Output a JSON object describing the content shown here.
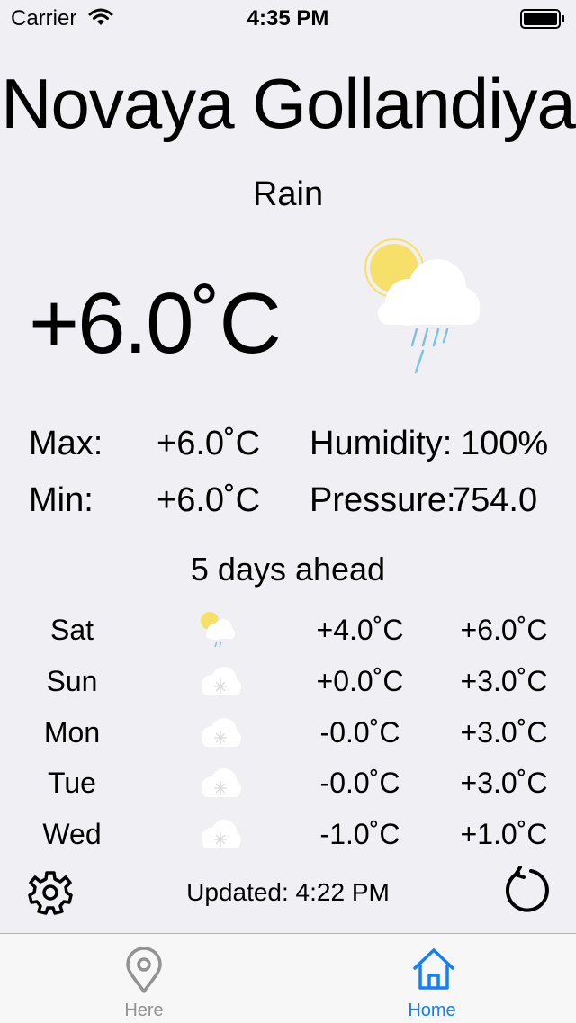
{
  "status_bar": {
    "carrier": "Carrier",
    "time": "4:35 PM"
  },
  "city": "Novaya Gollandiya",
  "condition": "Rain",
  "current_temp": "+6.0˚C",
  "stats": {
    "max_label": "Max:",
    "max_value": "+6.0˚C",
    "min_label": "Min:",
    "min_value": "+6.0˚C",
    "humidity_label": "Humidity:",
    "humidity_value": "100%",
    "pressure_label": "Pressure:",
    "pressure_value": "754.0"
  },
  "forecast_title": "5 days ahead",
  "forecast": [
    {
      "day": "Sat",
      "icon": "sun-rain-icon",
      "min": "+4.0˚C",
      "max": "+6.0˚C"
    },
    {
      "day": "Sun",
      "icon": "snow-cloud-icon",
      "min": "+0.0˚C",
      "max": "+3.0˚C"
    },
    {
      "day": "Mon",
      "icon": "snow-cloud-icon",
      "min": "-0.0˚C",
      "max": "+3.0˚C"
    },
    {
      "day": "Tue",
      "icon": "snow-cloud-icon",
      "min": "-0.0˚C",
      "max": "+3.0˚C"
    },
    {
      "day": "Wed",
      "icon": "snow-cloud-icon",
      "min": "-1.0˚C",
      "max": "+1.0˚C"
    }
  ],
  "updated": "Updated: 4:22 PM",
  "tabs": [
    {
      "label": "Here",
      "icon": "location-pin-icon",
      "selected": false
    },
    {
      "label": "Home",
      "icon": "home-icon",
      "selected": true
    }
  ],
  "colors": {
    "accent": "#147efb",
    "inactive": "#929292",
    "background": "#efeff4"
  }
}
